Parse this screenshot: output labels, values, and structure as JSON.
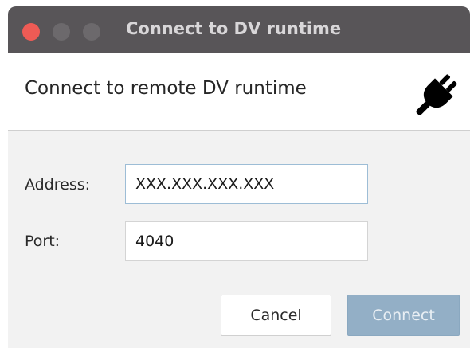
{
  "window": {
    "title": "Connect to DV runtime"
  },
  "header": {
    "text": "Connect to remote DV runtime",
    "icon": "plug-icon"
  },
  "form": {
    "address_label": "Address:",
    "address_value": "XXX.XXX.XXX.XXX",
    "port_label": "Port:",
    "port_value": "4040"
  },
  "buttons": {
    "cancel_label": "Cancel",
    "connect_label": "Connect"
  },
  "colors": {
    "titlebar": "#585558",
    "close_button": "#ee5b55",
    "connect_button": "#93afc6",
    "focused_border": "#9dbdd6"
  }
}
